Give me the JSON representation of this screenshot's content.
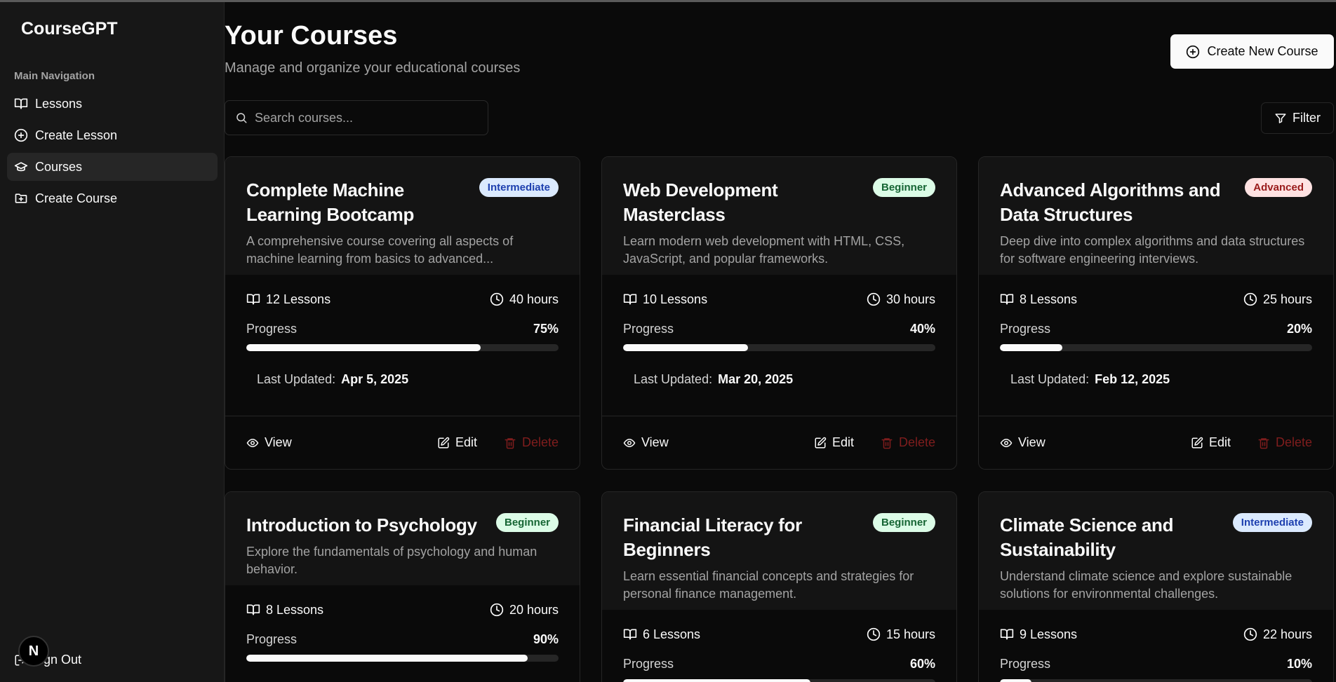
{
  "app": {
    "brand": "CourseGPT"
  },
  "sidebar": {
    "group_label": "Main Navigation",
    "items": [
      {
        "label": "Lessons",
        "icon": "book-open-icon",
        "active": false
      },
      {
        "label": "Create Lesson",
        "icon": "plus-circle-icon",
        "active": false
      },
      {
        "label": "Courses",
        "icon": "graduation-cap-icon",
        "active": true
      },
      {
        "label": "Create Course",
        "icon": "folder-plus-icon",
        "active": false
      }
    ],
    "sign_out": "Sign Out",
    "avatar_letter": "N"
  },
  "header": {
    "title": "Your Courses",
    "subtitle": "Manage and organize your educational courses",
    "create_button": "Create New Course",
    "search_placeholder": "Search courses...",
    "filter_button": "Filter"
  },
  "labels": {
    "progress": "Progress",
    "last_updated": "Last Updated:",
    "view": "View",
    "edit": "Edit",
    "delete": "Delete"
  },
  "courses": [
    {
      "title": "Complete Machine Learning Bootcamp",
      "level": "Intermediate",
      "level_color": "#dbeafe",
      "description": "A comprehensive course covering all aspects of machine learning from basics to advanced...",
      "lessons": "12 Lessons",
      "hours": "40 hours",
      "progress_text": "75%",
      "progress": 0.75,
      "updated": "Apr 5, 2025"
    },
    {
      "title": "Web Development Masterclass",
      "level": "Beginner",
      "level_color": "#dcfce7",
      "description": "Learn modern web development with HTML, CSS, JavaScript, and popular frameworks.",
      "lessons": "10 Lessons",
      "hours": "30 hours",
      "progress_text": "40%",
      "progress": 0.4,
      "updated": "Mar 20, 2025"
    },
    {
      "title": "Advanced Algorithms and Data Structures",
      "level": "Advanced",
      "level_color": "#fee2e2",
      "description": "Deep dive into complex algorithms and data structures for software engineering interviews.",
      "lessons": "8 Lessons",
      "hours": "25 hours",
      "progress_text": "20%",
      "progress": 0.2,
      "updated": "Feb 12, 2025"
    },
    {
      "title": "Introduction to Psychology",
      "level": "Beginner",
      "level_color": "#dcfce7",
      "description": "Explore the fundamentals of psychology and human behavior.",
      "lessons": "8 Lessons",
      "hours": "20 hours",
      "progress_text": "90%",
      "progress": 0.9
    },
    {
      "title": "Financial Literacy for Beginners",
      "level": "Beginner",
      "level_color": "#dcfce7",
      "description": "Learn essential financial concepts and strategies for personal finance management.",
      "lessons": "6 Lessons",
      "hours": "15 hours",
      "progress_text": "60%",
      "progress": 0.6
    },
    {
      "title": "Climate Science and Sustainability",
      "level": "Intermediate",
      "level_color": "#dbeafe",
      "description": "Understand climate science and explore sustainable solutions for environmental challenges.",
      "lessons": "9 Lessons",
      "hours": "22 hours",
      "progress_text": "10%",
      "progress": 0.1
    }
  ]
}
